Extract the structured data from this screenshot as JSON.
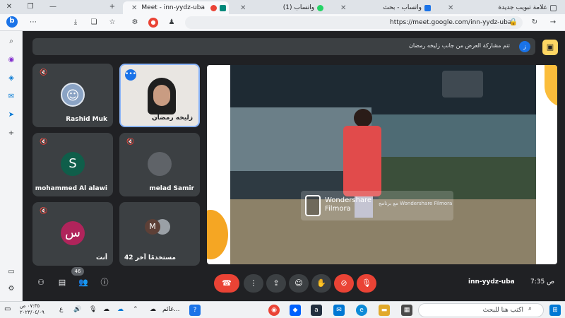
{
  "browser": {
    "tabs": [
      {
        "title": "علامة تبويب جديدة",
        "active": false
      },
      {
        "title": "واتساب - بحث",
        "active": false
      },
      {
        "title": "(1) واتساب",
        "active": false
      },
      {
        "title": "Meet - inn-yydz-uba",
        "active": true
      }
    ],
    "address": "https://meet.google.com/inn-yydz-uba",
    "accent": "#1a73e8"
  },
  "meet": {
    "banner_text": "تتم مشاركة العرض من جانب زليخه رمضان",
    "banner_avatar": "ز",
    "participants": [
      {
        "name": "Rashid Muk",
        "kind": "photo"
      },
      {
        "name": "زليخه رمضان",
        "kind": "video",
        "speaking": true
      },
      {
        "name": "mohammed Al alawi",
        "kind": "letter",
        "letter": "S",
        "color": "#0f5e4a"
      },
      {
        "name": "melad Samir",
        "kind": "blank"
      },
      {
        "name": "أنت",
        "kind": "letter",
        "letter": "س",
        "color": "#b0245b"
      },
      {
        "name": "42 مستخدمًا آخر",
        "kind": "group",
        "letter": "M"
      }
    ],
    "watermark": {
      "brand_line1": "Wondershare",
      "brand_line2": "Filmora",
      "sub_line1": "مع برنامج Wondershare Filmora"
    },
    "meeting_code": "inn-yydz-uba",
    "time": "7:35 ص",
    "people_count": "46"
  },
  "taskbar": {
    "search_placeholder": "اكتب هنا للبحث",
    "clock_time": "٠٧:٣٥ ص",
    "clock_date": "٢٠٢٣/٠٤/٠٩",
    "weather": "غائم...",
    "lang": "ع"
  }
}
